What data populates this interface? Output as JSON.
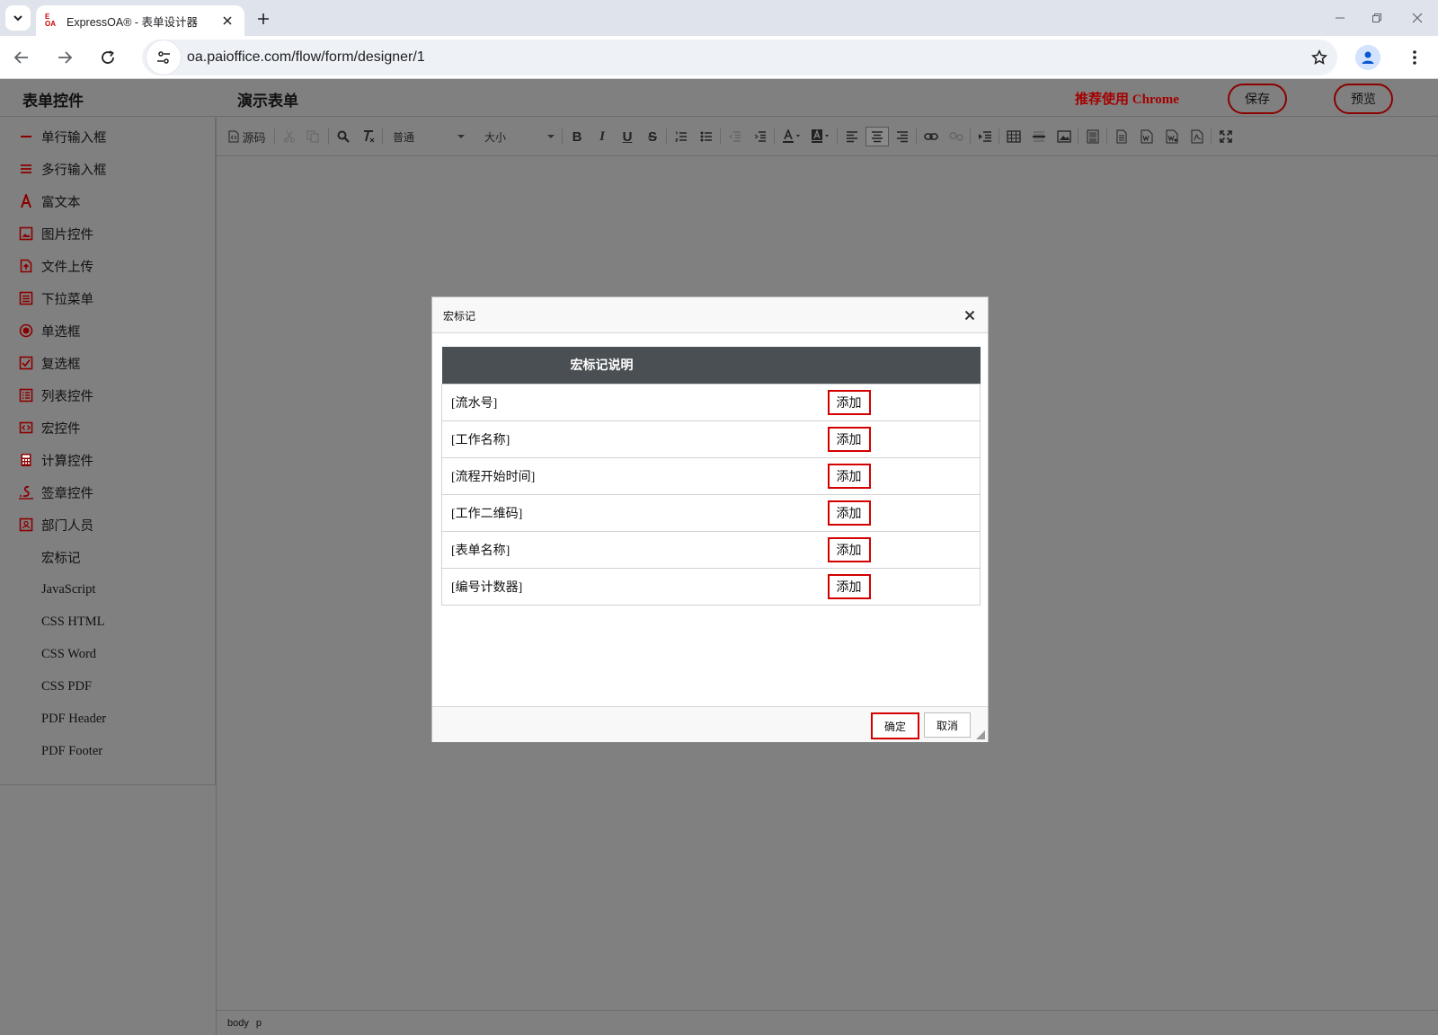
{
  "browser": {
    "tab_title": "ExpressOA® - 表单设计器",
    "favicon_text_top": "E",
    "favicon_text_bottom": "OA",
    "url": "oa.paioffice.com/flow/form/designer/1"
  },
  "app": {
    "sidebar_title": "表单控件",
    "form_title": "演示表单",
    "recommend_text": "推荐使用 Chrome",
    "save_label": "保存",
    "preview_label": "预览"
  },
  "sidebar": {
    "items": [
      {
        "label": "单行输入框",
        "icon": "single-line-icon"
      },
      {
        "label": "多行输入框",
        "icon": "multi-line-icon"
      },
      {
        "label": "富文本",
        "icon": "rich-text-icon"
      },
      {
        "label": "图片控件",
        "icon": "image-icon"
      },
      {
        "label": "文件上传",
        "icon": "file-upload-icon"
      },
      {
        "label": "下拉菜单",
        "icon": "dropdown-icon"
      },
      {
        "label": "单选框",
        "icon": "radio-icon"
      },
      {
        "label": "复选框",
        "icon": "checkbox-icon"
      },
      {
        "label": "列表控件",
        "icon": "list-icon"
      },
      {
        "label": "宏控件",
        "icon": "macro-icon"
      },
      {
        "label": "计算控件",
        "icon": "calculator-icon"
      },
      {
        "label": "签章控件",
        "icon": "signature-icon"
      },
      {
        "label": "部门人员",
        "icon": "department-icon"
      },
      {
        "label": "宏标记"
      },
      {
        "label": "JavaScript"
      },
      {
        "label": "CSS HTML"
      },
      {
        "label": "CSS Word"
      },
      {
        "label": "CSS PDF"
      },
      {
        "label": "PDF Header"
      },
      {
        "label": "PDF Footer"
      }
    ]
  },
  "editor": {
    "source_label": "源码",
    "format_select": "普通",
    "size_select": "大小",
    "statusbar": [
      "body",
      "p"
    ]
  },
  "dialog": {
    "title": "宏标记",
    "table_header": "宏标记说明",
    "rows": [
      {
        "name": "[流水号]",
        "action": "添加"
      },
      {
        "name": "[工作名称]",
        "action": "添加"
      },
      {
        "name": "[流程开始时间]",
        "action": "添加"
      },
      {
        "name": "[工作二维码]",
        "action": "添加"
      },
      {
        "name": "[表单名称]",
        "action": "添加"
      },
      {
        "name": "[编号计数器]",
        "action": "添加"
      }
    ],
    "ok_label": "确定",
    "cancel_label": "取消"
  },
  "colors": {
    "accent_red": "#d40000",
    "dark_red": "#8b0000",
    "overlay_gray": "#808080",
    "table_header_bg": "#4a4f53"
  }
}
